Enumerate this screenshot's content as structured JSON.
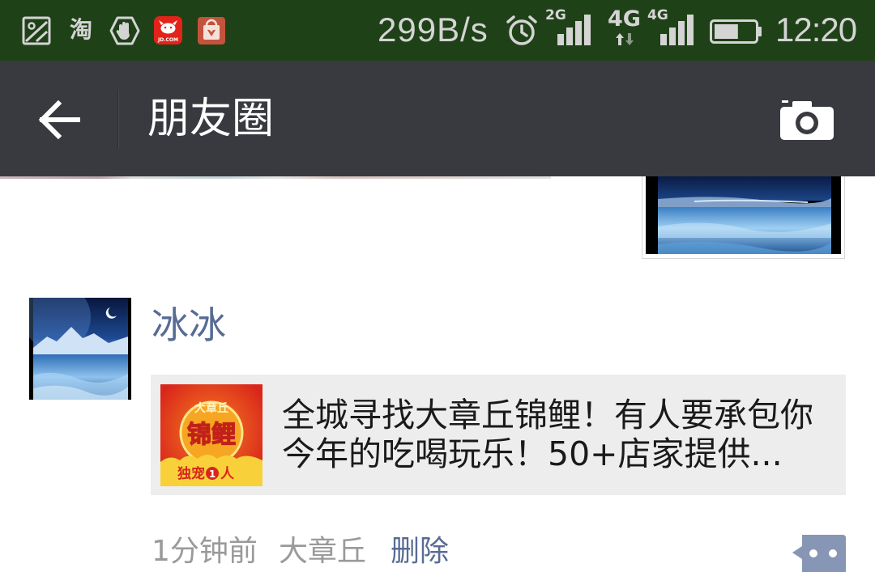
{
  "status_bar": {
    "icons_left": [
      "gallery-icon",
      "taobao-icon",
      "hand-stop-icon",
      "jd-app-icon",
      "app-market-icon"
    ],
    "taobao_glyph": "淘",
    "jd_logo_text": "JD.COM",
    "net_speed": "299B/s",
    "alarm_icon": "alarm-clock-icon",
    "sim1": {
      "network": "2G",
      "signal_level": 4
    },
    "data_network": "4G",
    "sim2": {
      "network": "4G",
      "signal_level": 4
    },
    "battery_level": 0.6,
    "time": "12:20"
  },
  "header": {
    "back_icon": "back-arrow-icon",
    "title": "朋友圈",
    "camera_icon": "camera-icon"
  },
  "post": {
    "author": "冰冰",
    "link": {
      "thumbnail_badge": "大章丘",
      "thumbnail_headline": "锦鲤",
      "thumbnail_footer_prefix": "独宠",
      "thumbnail_footer_number": "1",
      "thumbnail_footer_suffix": "人",
      "title": "全城寻找大章丘锦鲤！有人要承包你今年的吃喝玩乐！50+店家提供..."
    },
    "time": "1分钟前",
    "location": "大章丘",
    "delete_label": "删除",
    "comment_icon": "more-actions-icon"
  },
  "colors": {
    "status_bar_bg": "#1f4117",
    "status_text": "#d4d4d4",
    "header_bg": "#393a3f",
    "link_blue": "#576b95",
    "meta_gray": "#9a9a9a",
    "card_bg": "#ededed",
    "comment_button": "#8796b4"
  }
}
